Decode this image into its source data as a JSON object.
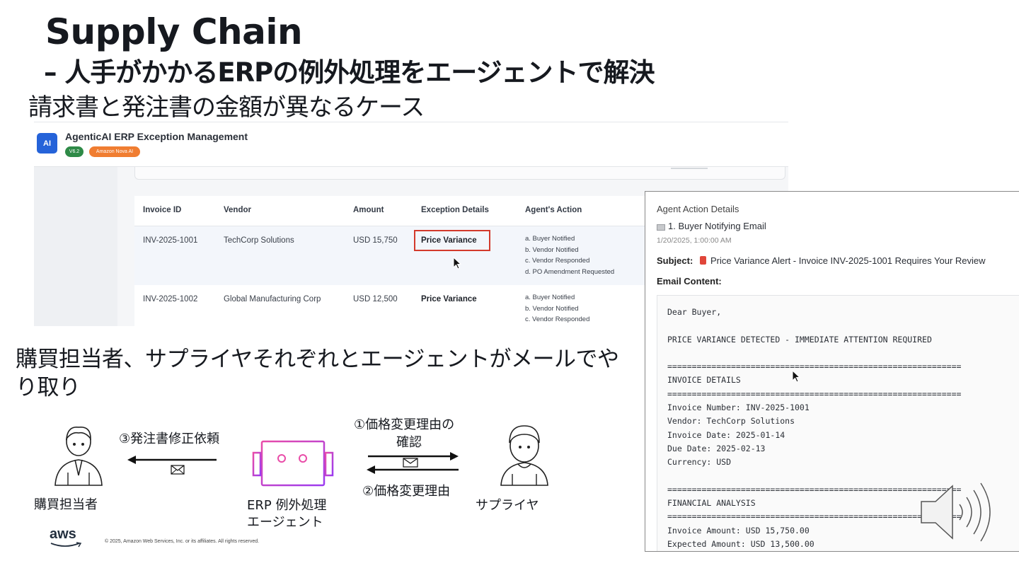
{
  "slide": {
    "title": "Supply Chain",
    "subtitle": "– 人手がかかるERPの例外処理をエージェントで解決",
    "case_heading": "請求書と発注書の金額が異なるケース",
    "narrative": "購買担当者、サプライヤそれぞれとエージェントがメールでやり取り",
    "copyright": "© 2025, Amazon Web Services, Inc. or its affiliates. All rights reserved.",
    "logo_text": "aws"
  },
  "app": {
    "logo": "AI",
    "title": "AgenticAI ERP Exception Management",
    "badges": [
      "V6.2",
      "Amazon Nova AI"
    ],
    "badge_colors": [
      "#2e8a47",
      "#f07d31"
    ],
    "columns": [
      "Invoice ID",
      "Vendor",
      "Amount",
      "Exception Details",
      "Agent's Action"
    ],
    "rows": [
      {
        "invoice_id": "INV-2025-1001",
        "vendor": "TechCorp Solutions",
        "amount": "USD 15,750",
        "exception": "Price Variance",
        "actions": [
          "a. Buyer Notified",
          "b. Vendor Notified",
          "c. Vendor Responded",
          "d. PO Amendment Requested"
        ]
      },
      {
        "invoice_id": "INV-2025-1002",
        "vendor": "Global Manufacturing Corp",
        "amount": "USD 12,500",
        "exception": "Price Variance",
        "actions": [
          "a. Buyer Notified",
          "b. Vendor Notified",
          "c. Vendor Responded"
        ]
      }
    ]
  },
  "email_panel": {
    "heading": "Agent Action Details",
    "item": "1. Buyer Notifying Email",
    "timestamp": "1/20/2025, 1:00:00 AM",
    "subject_label": "Subject:",
    "subject": "Price Variance Alert - Invoice INV-2025-1001 Requires Your Review",
    "content_label": "Email Content:",
    "body_lines": [
      "Dear Buyer,",
      "",
      "PRICE VARIANCE DETECTED - IMMEDIATE ATTENTION REQUIRED",
      "",
      "============================================================",
      "INVOICE DETAILS",
      "============================================================",
      "Invoice Number: INV-2025-1001",
      "Vendor: TechCorp Solutions",
      "Invoice Date: 2025-01-14",
      "Due Date: 2025-02-13",
      "Currency: USD",
      "",
      "============================================================",
      "FINANCIAL ANALYSIS",
      "============================================================",
      "Invoice Amount: USD 15,750.00",
      "Expected Amount: USD 13,500.00"
    ]
  },
  "diagram": {
    "buyer_label": "購買担当者",
    "agent_label_1": "ERP 例外処理",
    "agent_label_2": "エージェント",
    "supplier_label": "サプライヤ",
    "step1_line1": "①価格変更理由の",
    "step1_line2": "確認",
    "step2": "②価格変更理由",
    "step3": "③発注書修正依頼",
    "mail_glyph": "✉"
  }
}
